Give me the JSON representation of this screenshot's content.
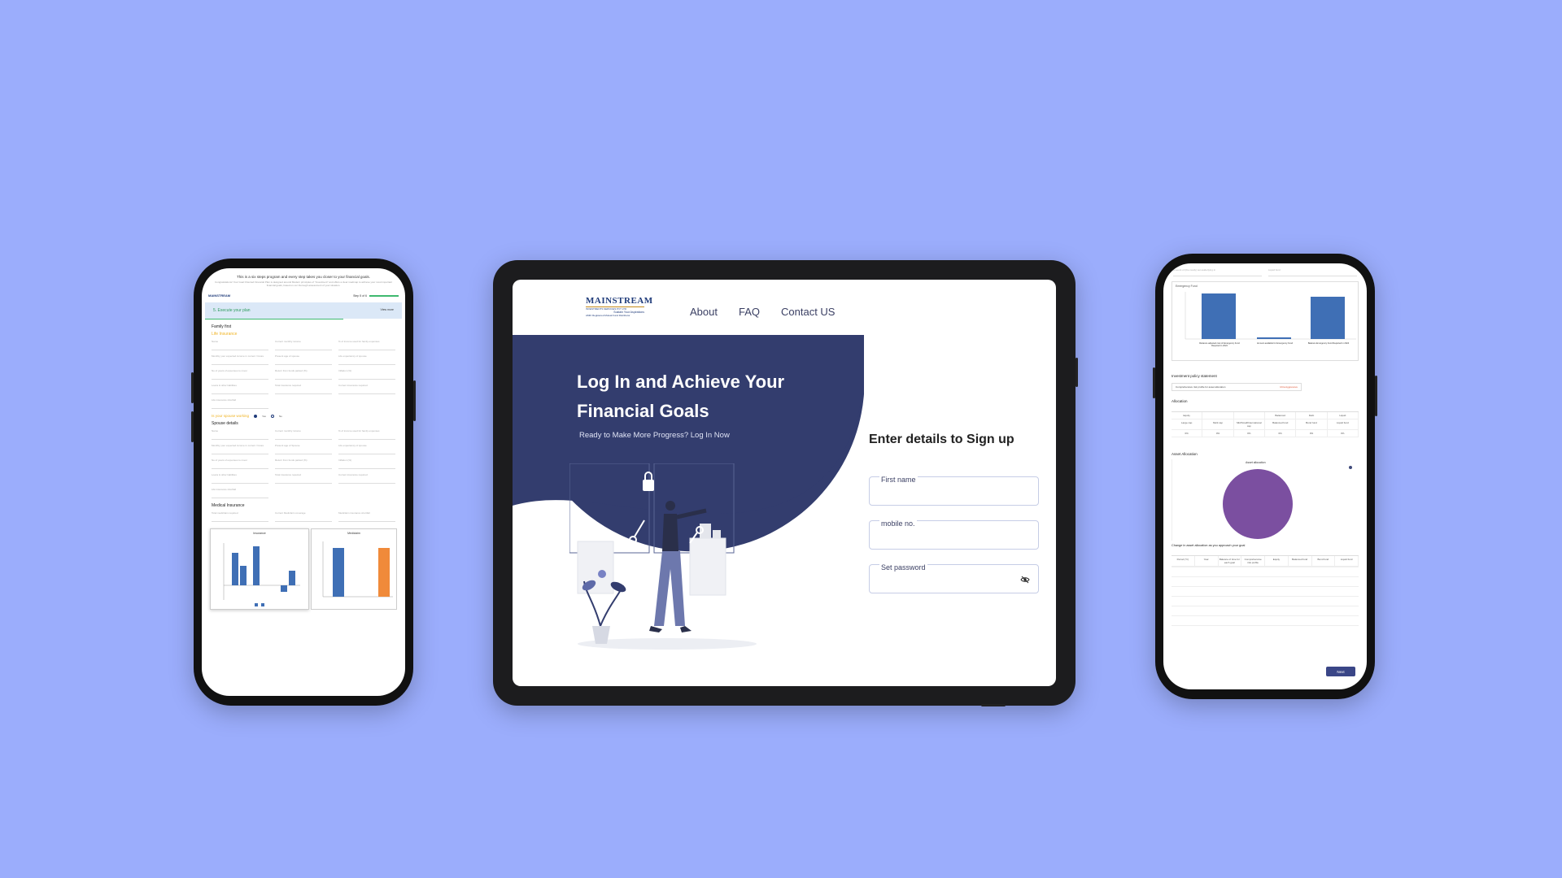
{
  "left_phone": {
    "intro_title": "This is a six steps program and every step takes you closer to your financial goals.",
    "intro_sub": "Congratulations! Your Goal Oriented Financial Plan is designed around Modern principles of \"Investment\" and offers a clear roadmap to achieve your most important financial goals, based on our thorough assessment of your situation.",
    "brand": "MAINSTREAM",
    "step_indicator": "Step 5 of 6",
    "section_title": "5. Execute your plan",
    "section_action": "View more",
    "family_first": "Family first",
    "life_insurance": "Life Insurance",
    "life_fields": [
      "Name",
      "Current monthly income",
      "% of income used for family expenses",
      "Monthly your expected income in current / future",
      "Present age of spouse",
      "Life expectancy of spouse",
      "No of years of expenses to cover",
      "Return from funds parked (%)",
      "Inflation (%)",
      "Loans & other liabilities",
      "Total insurance required",
      "Current insurance required",
      "Life insurance shortfall"
    ],
    "spouse_working": "Is your spouse working",
    "spouse_yes": "Yes",
    "spouse_no": "No",
    "spouse_details": "Spouse details",
    "spouse_fields": [
      "Name",
      "Current monthly income",
      "% of income used for family expenses",
      "Monthly your expected income in current / future",
      "Present age of Spouse",
      "Life expectancy of spouse",
      "No of years of expenses to cover",
      "Return from funds parked (%)",
      "Inflation (%)",
      "Loans & other liabilities",
      "Total insurance required",
      "Current insurance required",
      "Life insurance shortfall"
    ],
    "medical_insurance": "Medical Insurance",
    "medical_fields": [
      "Total mediclaim required",
      "Current Mediclaim coverage",
      "Mediclaim insurance shortfall"
    ],
    "chart1_title": "Insurance",
    "chart2_title": "Mediclaim"
  },
  "center_tablet": {
    "logo": {
      "name": "MAINSTREAM",
      "tagline1": "INVESTMENTS SERVICES PVT LTD",
      "tagline2": "Sustain Your Aspirations",
      "tagline3": "AMFI Registered Mutual Fund Distributor"
    },
    "nav": {
      "about": "About",
      "faq": "FAQ",
      "contact": "Contact US"
    },
    "hero": {
      "title": "Log In and Achieve Your Financial Goals",
      "subtitle": "Ready to Make More Progress? Log In Now"
    },
    "form": {
      "title": "Enter details to Sign up",
      "first_name_label": "First name",
      "mobile_label": "mobile no.",
      "password_label": "Set password"
    },
    "colors": {
      "hero_bg": "#333d6e",
      "accent": "#3a4687"
    }
  },
  "right_phone": {
    "top_fields": [
      "Amount of (the ready) set aside/lying in",
      "Liquid fund"
    ],
    "emergency_title": "Emergency Fund",
    "emergency_bars": [
      "Reliance adjusted cost of Emergency Fund Required in 2024",
      "Amount available for Emergency Fund",
      "Balance Emergency Fund Required in 2024"
    ],
    "ips_title": "Investment policy statement",
    "ips_label": "Comprehensive risk profile for asset allocation",
    "ips_value": "Ultra Aggressive",
    "allocation_title": "Allocation",
    "allocation_headers": [
      "Equity",
      "",
      "",
      "Balanced",
      "Debt",
      "Liquid"
    ],
    "allocation_sub": [
      "Large cap",
      "Multi cap",
      "Mid/Small/International cap",
      "Balanced fund",
      "Bond fund",
      "Liquid fund"
    ],
    "allocation_values": [
      "0%",
      "0%",
      "0%",
      "0%",
      "0%",
      "0%"
    ],
    "asset_allocation_title": "Asset Allocation",
    "pie_title": "Asset allocation",
    "change_title": "Change in asset allocation as you approach your goal",
    "change_headers": [
      "Period (Yr)",
      "Year",
      "Balance of time for each goal",
      "Comprehensive risk profile",
      "Equity",
      "Balanced fund",
      "Bond fund",
      "Liquid fund"
    ],
    "next_button": "Next"
  }
}
